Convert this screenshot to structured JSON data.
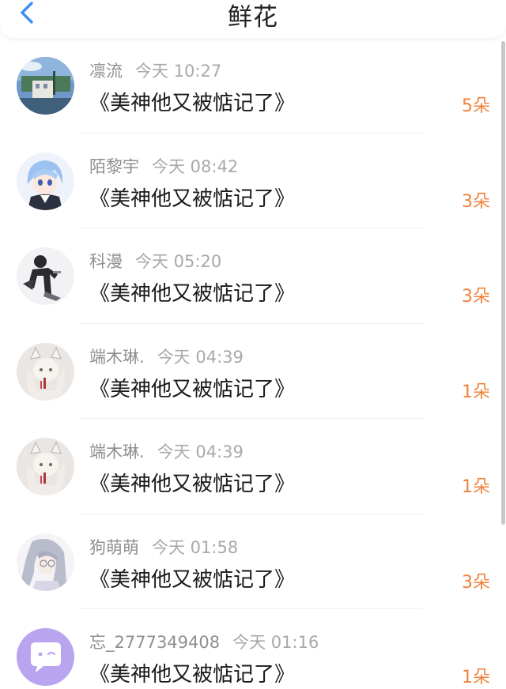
{
  "header": {
    "title": "鲜花",
    "back_icon": "chevron-left-icon",
    "accent": "#3a8ef6"
  },
  "items": [
    {
      "user": "凛流",
      "time": "今天 10:27",
      "book": "《美神他又被惦记了》",
      "count": "5朵",
      "avatar": "landscape-avatar"
    },
    {
      "user": "陌黎宇",
      "time": "今天 08:42",
      "book": "《美神他又被惦记了》",
      "count": "3朵",
      "avatar": "anime-blue-hair-avatar"
    },
    {
      "user": "科漫",
      "time": "今天 05:20",
      "book": "《美神他又被惦记了》",
      "count": "3朵",
      "avatar": "dark-figure-avatar"
    },
    {
      "user": "端木琳.",
      "time": "今天 04:39",
      "book": "《美神他又被惦记了》",
      "count": "1朵",
      "avatar": "white-fox-avatar"
    },
    {
      "user": "端木琳.",
      "time": "今天 04:39",
      "book": "《美神他又被惦记了》",
      "count": "1朵",
      "avatar": "white-fox-avatar"
    },
    {
      "user": "狗萌萌",
      "time": "今天 01:58",
      "book": "《美神他又被惦记了》",
      "count": "3朵",
      "avatar": "silver-hair-avatar"
    },
    {
      "user": "忘_2777349408",
      "time": "今天 01:16",
      "book": "《美神他又被惦记了》",
      "count": "1朵",
      "avatar": "default-chat-avatar"
    }
  ],
  "colors": {
    "count": "#f0823a",
    "username": "#8f8f8f",
    "time": "#a9a9a9",
    "default_avatar": "#b9a4f0"
  }
}
